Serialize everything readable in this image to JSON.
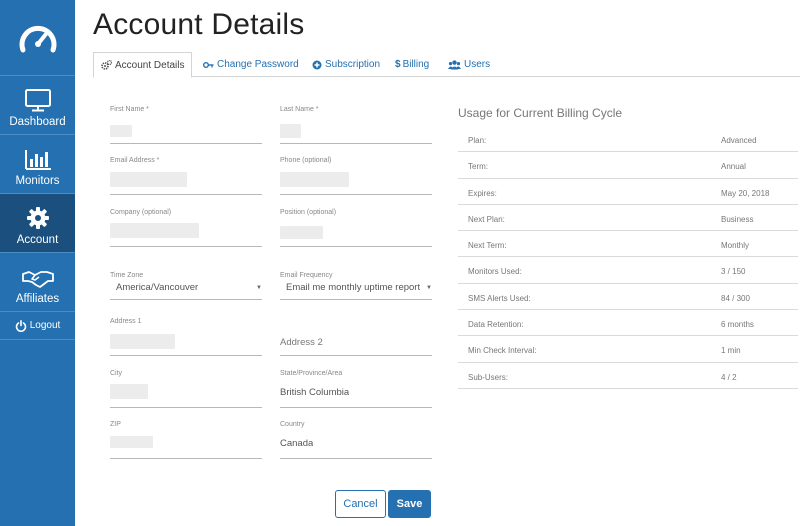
{
  "sidebar": {
    "items": [
      {
        "label": "Dashboard",
        "icon": "monitor-icon"
      },
      {
        "label": "Monitors",
        "icon": "bar-chart-icon"
      },
      {
        "label": "Account",
        "icon": "gear-icon",
        "active": true
      },
      {
        "label": "Affiliates",
        "icon": "handshake-icon"
      }
    ],
    "logout_label": "Logout"
  },
  "page_title": "Account Details",
  "tabs": [
    {
      "label": "Account Details",
      "icon": "gears-icon",
      "active": true
    },
    {
      "label": "Change Password",
      "icon": "key-icon"
    },
    {
      "label": "Subscription",
      "icon": "plus-circle-icon"
    },
    {
      "label": "Billing",
      "icon": "dollar-icon"
    },
    {
      "label": "Users",
      "icon": "users-icon"
    }
  ],
  "form": {
    "first_name_label": "First Name *",
    "last_name_label": "Last Name *",
    "email_label": "Email Address *",
    "phone_label": "Phone (optional)",
    "company_label": "Company (optional)",
    "position_label": "Position (optional)",
    "timezone_label": "Time Zone",
    "timezone_value": "America/Vancouver",
    "email_freq_label": "Email Frequency",
    "email_freq_value": "Email me monthly uptime reports",
    "address1_label": "Address 1",
    "address2_placeholder": "Address 2",
    "city_label": "City",
    "state_label": "State/Province/Area",
    "state_value": "British Columbia",
    "zip_label": "ZIP",
    "country_label": "Country",
    "country_value": "Canada"
  },
  "buttons": {
    "cancel_label": "Cancel",
    "save_label": "Save"
  },
  "usage": {
    "title": "Usage for Current Billing Cycle",
    "rows": [
      {
        "key": "Plan:",
        "value": "Advanced"
      },
      {
        "key": "Term:",
        "value": "Annual"
      },
      {
        "key": "Expires:",
        "value": "May 20, 2018"
      },
      {
        "key": "Next Plan:",
        "value": "Business"
      },
      {
        "key": "Next Term:",
        "value": "Monthly"
      },
      {
        "key": "Monitors Used:",
        "value": "3 / 150"
      },
      {
        "key": "SMS Alerts Used:",
        "value": "84 / 300"
      },
      {
        "key": "Data Retention:",
        "value": "6 months"
      },
      {
        "key": "Min Check Interval:",
        "value": "1 min"
      },
      {
        "key": "Sub-Users:",
        "value": "4 / 2"
      }
    ]
  },
  "colors": {
    "brand": "#2470b0",
    "sidebar_active": "#1a4f7e"
  }
}
